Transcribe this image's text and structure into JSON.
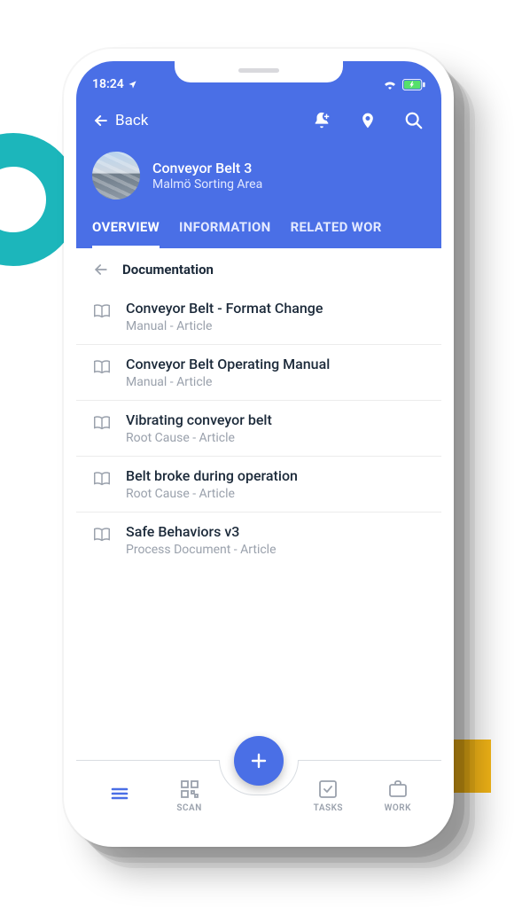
{
  "status": {
    "time": "18:24"
  },
  "header": {
    "back_label": "Back",
    "asset_title": "Conveyor Belt 3",
    "asset_subtitle": "Malmö Sorting Area"
  },
  "tabs": [
    {
      "label": "OVERVIEW",
      "active": true
    },
    {
      "label": "INFORMATION",
      "active": false
    },
    {
      "label": "RELATED WOR",
      "active": false
    }
  ],
  "section": {
    "title": "Documentation"
  },
  "documents": [
    {
      "title": "Conveyor Belt - Format Change",
      "subtitle": "Manual - Article"
    },
    {
      "title": "Conveyor Belt Operating Manual",
      "subtitle": "Manual - Article"
    },
    {
      "title": "Vibrating conveyor belt",
      "subtitle": "Root Cause - Article"
    },
    {
      "title": "Belt broke during operation",
      "subtitle": "Root Cause - Article"
    },
    {
      "title": "Safe Behaviors v3",
      "subtitle": "Process Document - Article"
    }
  ],
  "bottom_nav": {
    "menu": "",
    "scan": "SCAN",
    "tasks": "TASKS",
    "work": "WORK"
  },
  "colors": {
    "primary": "#4a6fe6",
    "accent_teal": "#1cb6bb",
    "accent_yellow": "#f4b617"
  }
}
